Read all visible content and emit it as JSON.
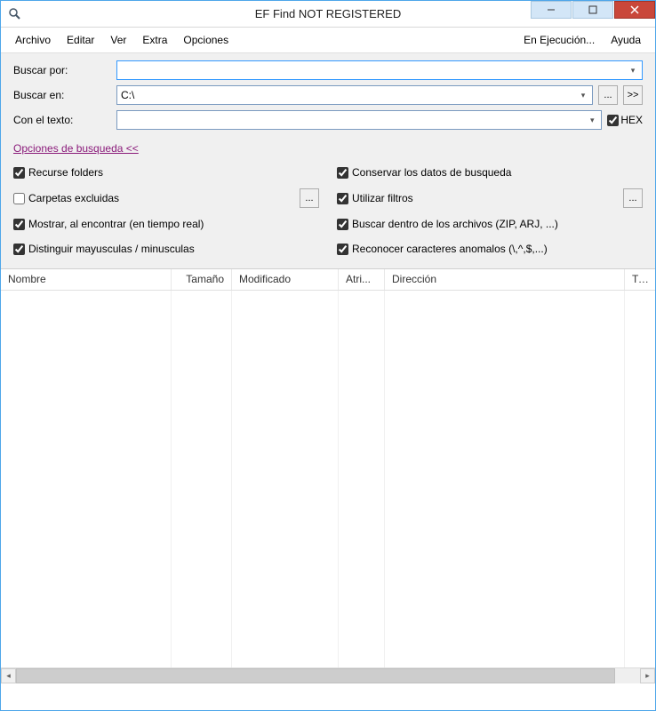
{
  "window": {
    "title": "EF Find NOT REGISTERED"
  },
  "menu": {
    "archivo": "Archivo",
    "editar": "Editar",
    "ver": "Ver",
    "extra": "Extra",
    "opciones": "Opciones",
    "en_ejecucion": "En Ejecución...",
    "ayuda": "Ayuda"
  },
  "form": {
    "buscar_por_label": "Buscar por:",
    "buscar_por_value": "",
    "buscar_en_label": "Buscar en:",
    "buscar_en_value": "C:\\",
    "con_texto_label": "Con el texto:",
    "con_texto_value": "",
    "browse_btn": "...",
    "forward_btn": ">>",
    "hex_label": "HEX"
  },
  "search_options_link": "Opciones de busqueda  <<",
  "options": {
    "recurse_folders": {
      "label": "Recurse folders",
      "checked": true
    },
    "carpetas_excluidas": {
      "label": "Carpetas excluidas",
      "checked": false,
      "btn": "..."
    },
    "mostrar_encontrar": {
      "label": "Mostrar, al encontrar (en tiempo real)",
      "checked": true
    },
    "distinguir_may": {
      "label": "Distinguir mayusculas / minusculas",
      "checked": true
    },
    "conservar_datos": {
      "label": "Conservar los datos de busqueda",
      "checked": true
    },
    "utilizar_filtros": {
      "label": "Utilizar filtros",
      "checked": true,
      "btn": "..."
    },
    "buscar_dentro": {
      "label": "Buscar dentro de los archivos (ZIP, ARJ, ...)",
      "checked": true
    },
    "reconocer_anom": {
      "label": "Reconocer caracteres anomalos (\\,^,$,...)",
      "checked": true
    }
  },
  "columns": {
    "nombre": "Nombre",
    "tamano": "Tamaño",
    "modificado": "Modificado",
    "atri": "Atri...",
    "direccion": "Dirección",
    "tip": "Tip"
  },
  "col_widths": {
    "nombre": 192,
    "tamano": 68,
    "modificado": 120,
    "atri": 52,
    "direccion": 270,
    "tip": 30
  }
}
